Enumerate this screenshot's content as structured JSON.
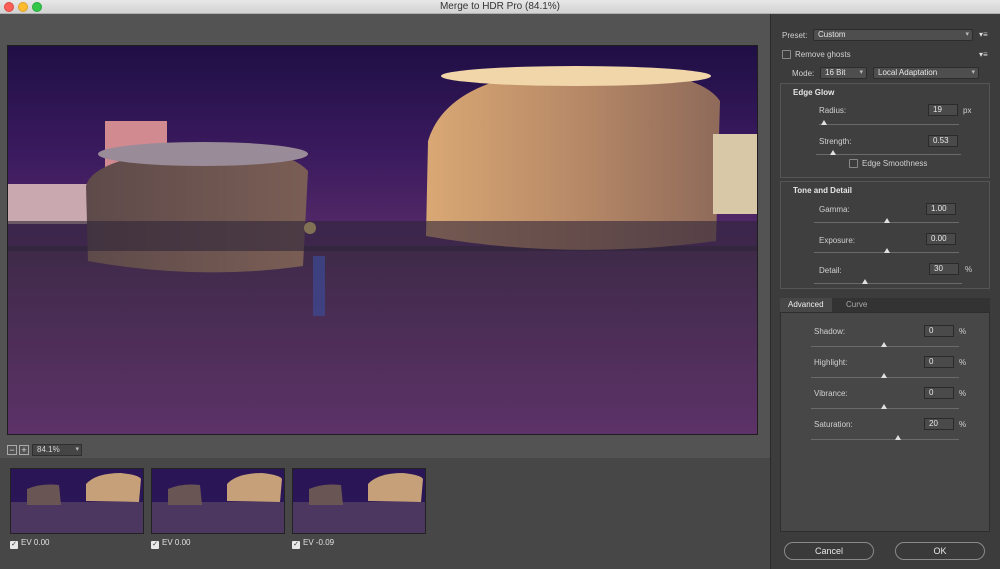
{
  "window": {
    "title": "Merge to HDR Pro (84.1%)"
  },
  "preview": {
    "zoom": "84.1%"
  },
  "thumbnails": [
    {
      "label": "EV 0.00",
      "checked": true
    },
    {
      "label": "EV 0.00",
      "checked": true
    },
    {
      "label": "EV -0.09",
      "checked": true
    }
  ],
  "preset": {
    "label": "Preset:",
    "value": "Custom"
  },
  "remove_ghosts": {
    "label": "Remove ghosts",
    "checked": false
  },
  "mode": {
    "label": "Mode:",
    "bit_depth": "16 Bit",
    "method": "Local Adaptation"
  },
  "edge_glow": {
    "title": "Edge Glow",
    "radius": {
      "label": "Radius:",
      "value": "19",
      "unit": "px",
      "slider": 0.02
    },
    "strength": {
      "label": "Strength:",
      "value": "0.53",
      "slider": 0.12
    },
    "smoothness_label": "Edge Smoothness"
  },
  "tone_detail": {
    "title": "Tone and Detail",
    "gamma": {
      "label": "Gamma:",
      "value": "1.00",
      "slider": 0.5
    },
    "exposure": {
      "label": "Exposure:",
      "value": "0.00",
      "slider": 0.5
    },
    "detail": {
      "label": "Detail:",
      "value": "30",
      "unit": "%",
      "slider": 0.33
    }
  },
  "tabs": {
    "advanced": "Advanced",
    "curve": "Curve"
  },
  "advanced": {
    "shadow": {
      "label": "Shadow:",
      "value": "0",
      "unit": "%",
      "slider": 0.5
    },
    "highlight": {
      "label": "Highlight:",
      "value": "0",
      "unit": "%",
      "slider": 0.5
    },
    "vibrance": {
      "label": "Vibrance:",
      "value": "0",
      "unit": "%",
      "slider": 0.5
    },
    "saturation": {
      "label": "Saturation:",
      "value": "20",
      "unit": "%",
      "slider": 0.6
    }
  },
  "buttons": {
    "cancel": "Cancel",
    "ok": "OK"
  },
  "colors": {
    "panel": "#3c3c3c",
    "preview_bg": "#535353",
    "sky": "#2a1450",
    "ground": "#4a2f55"
  }
}
